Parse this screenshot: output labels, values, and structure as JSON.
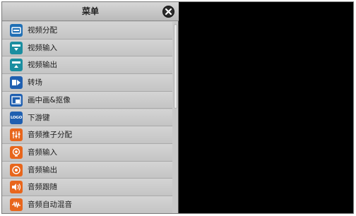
{
  "menu": {
    "title": "菜单",
    "close_icon": "close-icon",
    "items": [
      {
        "label": "视频分配",
        "icon": "video-split-icon",
        "color": "#1f6fb5"
      },
      {
        "label": "视频输入",
        "icon": "video-input-icon",
        "color": "#1b8ea0"
      },
      {
        "label": "视频输出",
        "icon": "video-output-icon",
        "color": "#1b8ea0"
      },
      {
        "label": "转场",
        "icon": "transition-icon",
        "color": "#1f5fb0"
      },
      {
        "label": "画中画&抠像",
        "icon": "pip-keying-icon",
        "color": "#1f5fb0"
      },
      {
        "label": "下游键",
        "icon": "logo-key-icon",
        "color": "#1f5fb0",
        "icon_text": "LOGO"
      },
      {
        "label": "音频推子分配",
        "icon": "audio-fader-icon",
        "color": "#e8661c"
      },
      {
        "label": "音频输入",
        "icon": "audio-input-icon",
        "color": "#e8661c"
      },
      {
        "label": "音频输出",
        "icon": "audio-output-icon",
        "color": "#e8661c"
      },
      {
        "label": "音频跟随",
        "icon": "audio-follow-icon",
        "color": "#e8661c"
      },
      {
        "label": "音频自动混音",
        "icon": "audio-automix-icon",
        "color": "#e8661c"
      }
    ]
  },
  "colors": {
    "panel": "#c9c9c9",
    "preview": "#000000"
  }
}
